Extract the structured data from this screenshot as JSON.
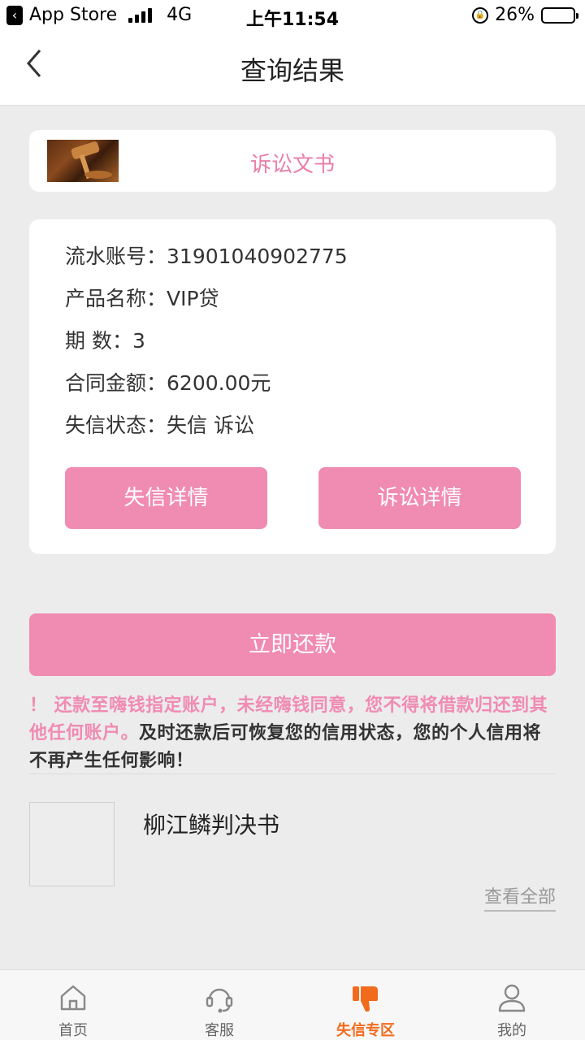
{
  "status_bar": {
    "back_app": "App Store",
    "network": "4G",
    "time": "上午11:54",
    "battery_percent": "26%",
    "battery_level": 0.26
  },
  "nav": {
    "title": "查询结果"
  },
  "doc_card": {
    "title": "诉讼文书"
  },
  "info": {
    "rows": [
      {
        "label": "流水账号：",
        "value": "31901040902775"
      },
      {
        "label": "产品名称：",
        "value": "VIP贷"
      },
      {
        "label": "期 数：",
        "value": "3"
      },
      {
        "label": "合同金额：",
        "value": "6200.00元"
      },
      {
        "label": "失信状态：",
        "value": "失信 诉讼"
      }
    ],
    "buttons": {
      "default_detail": "失信详情",
      "litigation_detail": "诉讼详情"
    }
  },
  "repay": {
    "label": "立即还款"
  },
  "notice": {
    "warning": "！ 还款至嗨钱指定账户，未经嗨钱同意，您不得将借款归还到其他任何账户。",
    "info": "及时还款后可恢复您的信用状态，您的个人信用将不再产生任何影响！"
  },
  "verdict": {
    "title": "柳江鳞判决书",
    "view_all": "查看全部"
  },
  "tab_bar": {
    "items": [
      {
        "label": "首页",
        "icon": "home-icon",
        "active": false
      },
      {
        "label": "客服",
        "icon": "headset-icon",
        "active": false
      },
      {
        "label": "失信专区",
        "icon": "thumbs-down-icon",
        "active": true
      },
      {
        "label": "我的",
        "icon": "user-icon",
        "active": false
      }
    ],
    "active_color": "#f26b1d"
  },
  "colors": {
    "accent_pink": "#f08bb2",
    "background": "#ececec"
  }
}
